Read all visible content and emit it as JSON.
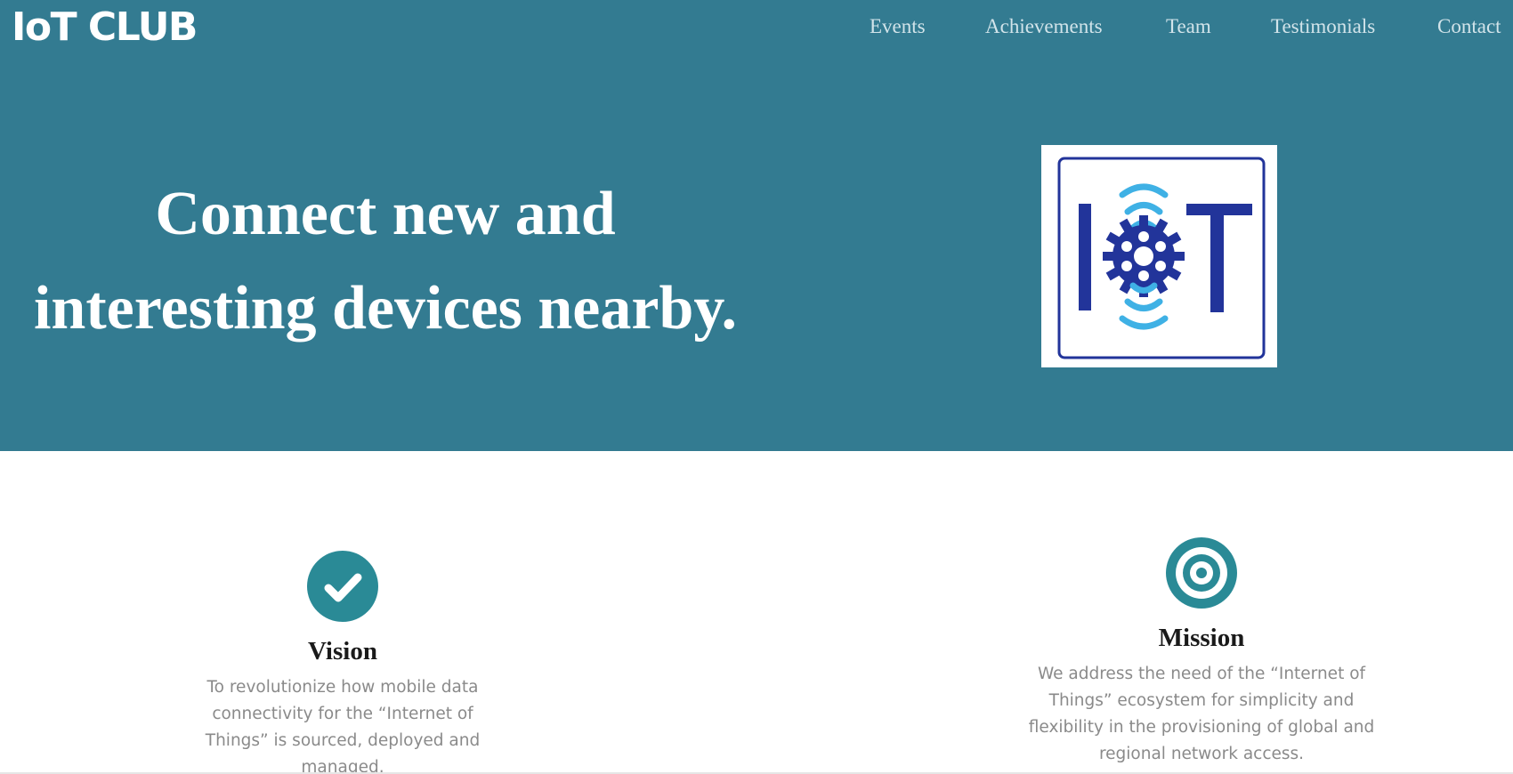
{
  "header": {
    "brand": "IoT CLUB",
    "nav": [
      "Events",
      "Achievements",
      "Team",
      "Testimonials",
      "Contact"
    ]
  },
  "hero": {
    "headline_line1": "Connect new and",
    "headline_line2": "interesting devices nearby."
  },
  "features": [
    {
      "title": "Vision",
      "text": "To revolutionize how mobile data connectivity for the “Internet of Things” is sourced, deployed and managed.",
      "icon": "checkmark-circle-icon"
    },
    {
      "title": "Mission",
      "text": "We address the need of the “Internet of Things” ecosystem for simplicity and flexibility in the provisioning of global and regional network access.",
      "icon": "target-icon"
    }
  ],
  "colors": {
    "hero_bg": "#337b91",
    "icon_teal": "#2a8a96",
    "logo_navy": "#22349a",
    "logo_cyan": "#3fb1e5"
  }
}
